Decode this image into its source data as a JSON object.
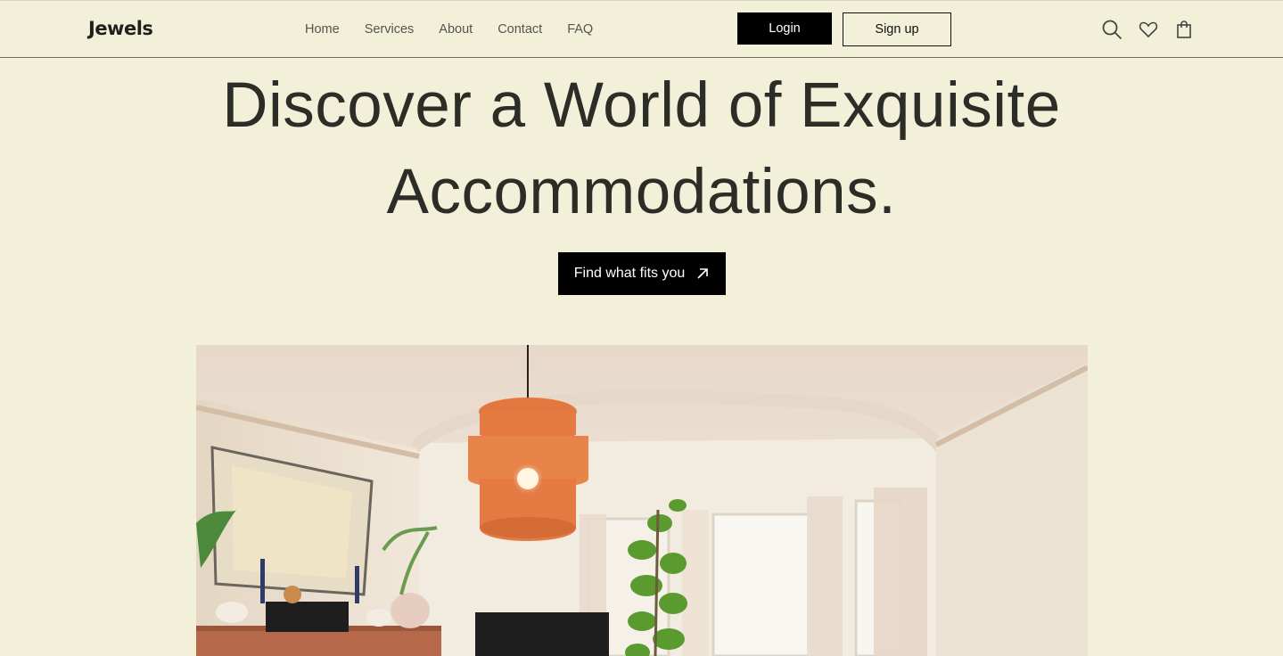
{
  "brand": {
    "name": "Jewels"
  },
  "nav": {
    "items": [
      "Home",
      "Services",
      "About",
      "Contact",
      "FAQ"
    ]
  },
  "auth": {
    "login_label": "Login",
    "signup_label": "Sign up"
  },
  "header_icons": [
    "search-icon",
    "heart-icon",
    "shopping-bag-icon"
  ],
  "hero": {
    "title": "Discover a World of Exquisite Accommodations.",
    "cta_label": "Find what fits you",
    "cta_icon": "arrow-up-right-icon",
    "image": "living-room-photo"
  },
  "colors": {
    "background": "#f3f0da",
    "text": "#2d2d28",
    "button": "#000000",
    "lamp": "#e57a43"
  }
}
